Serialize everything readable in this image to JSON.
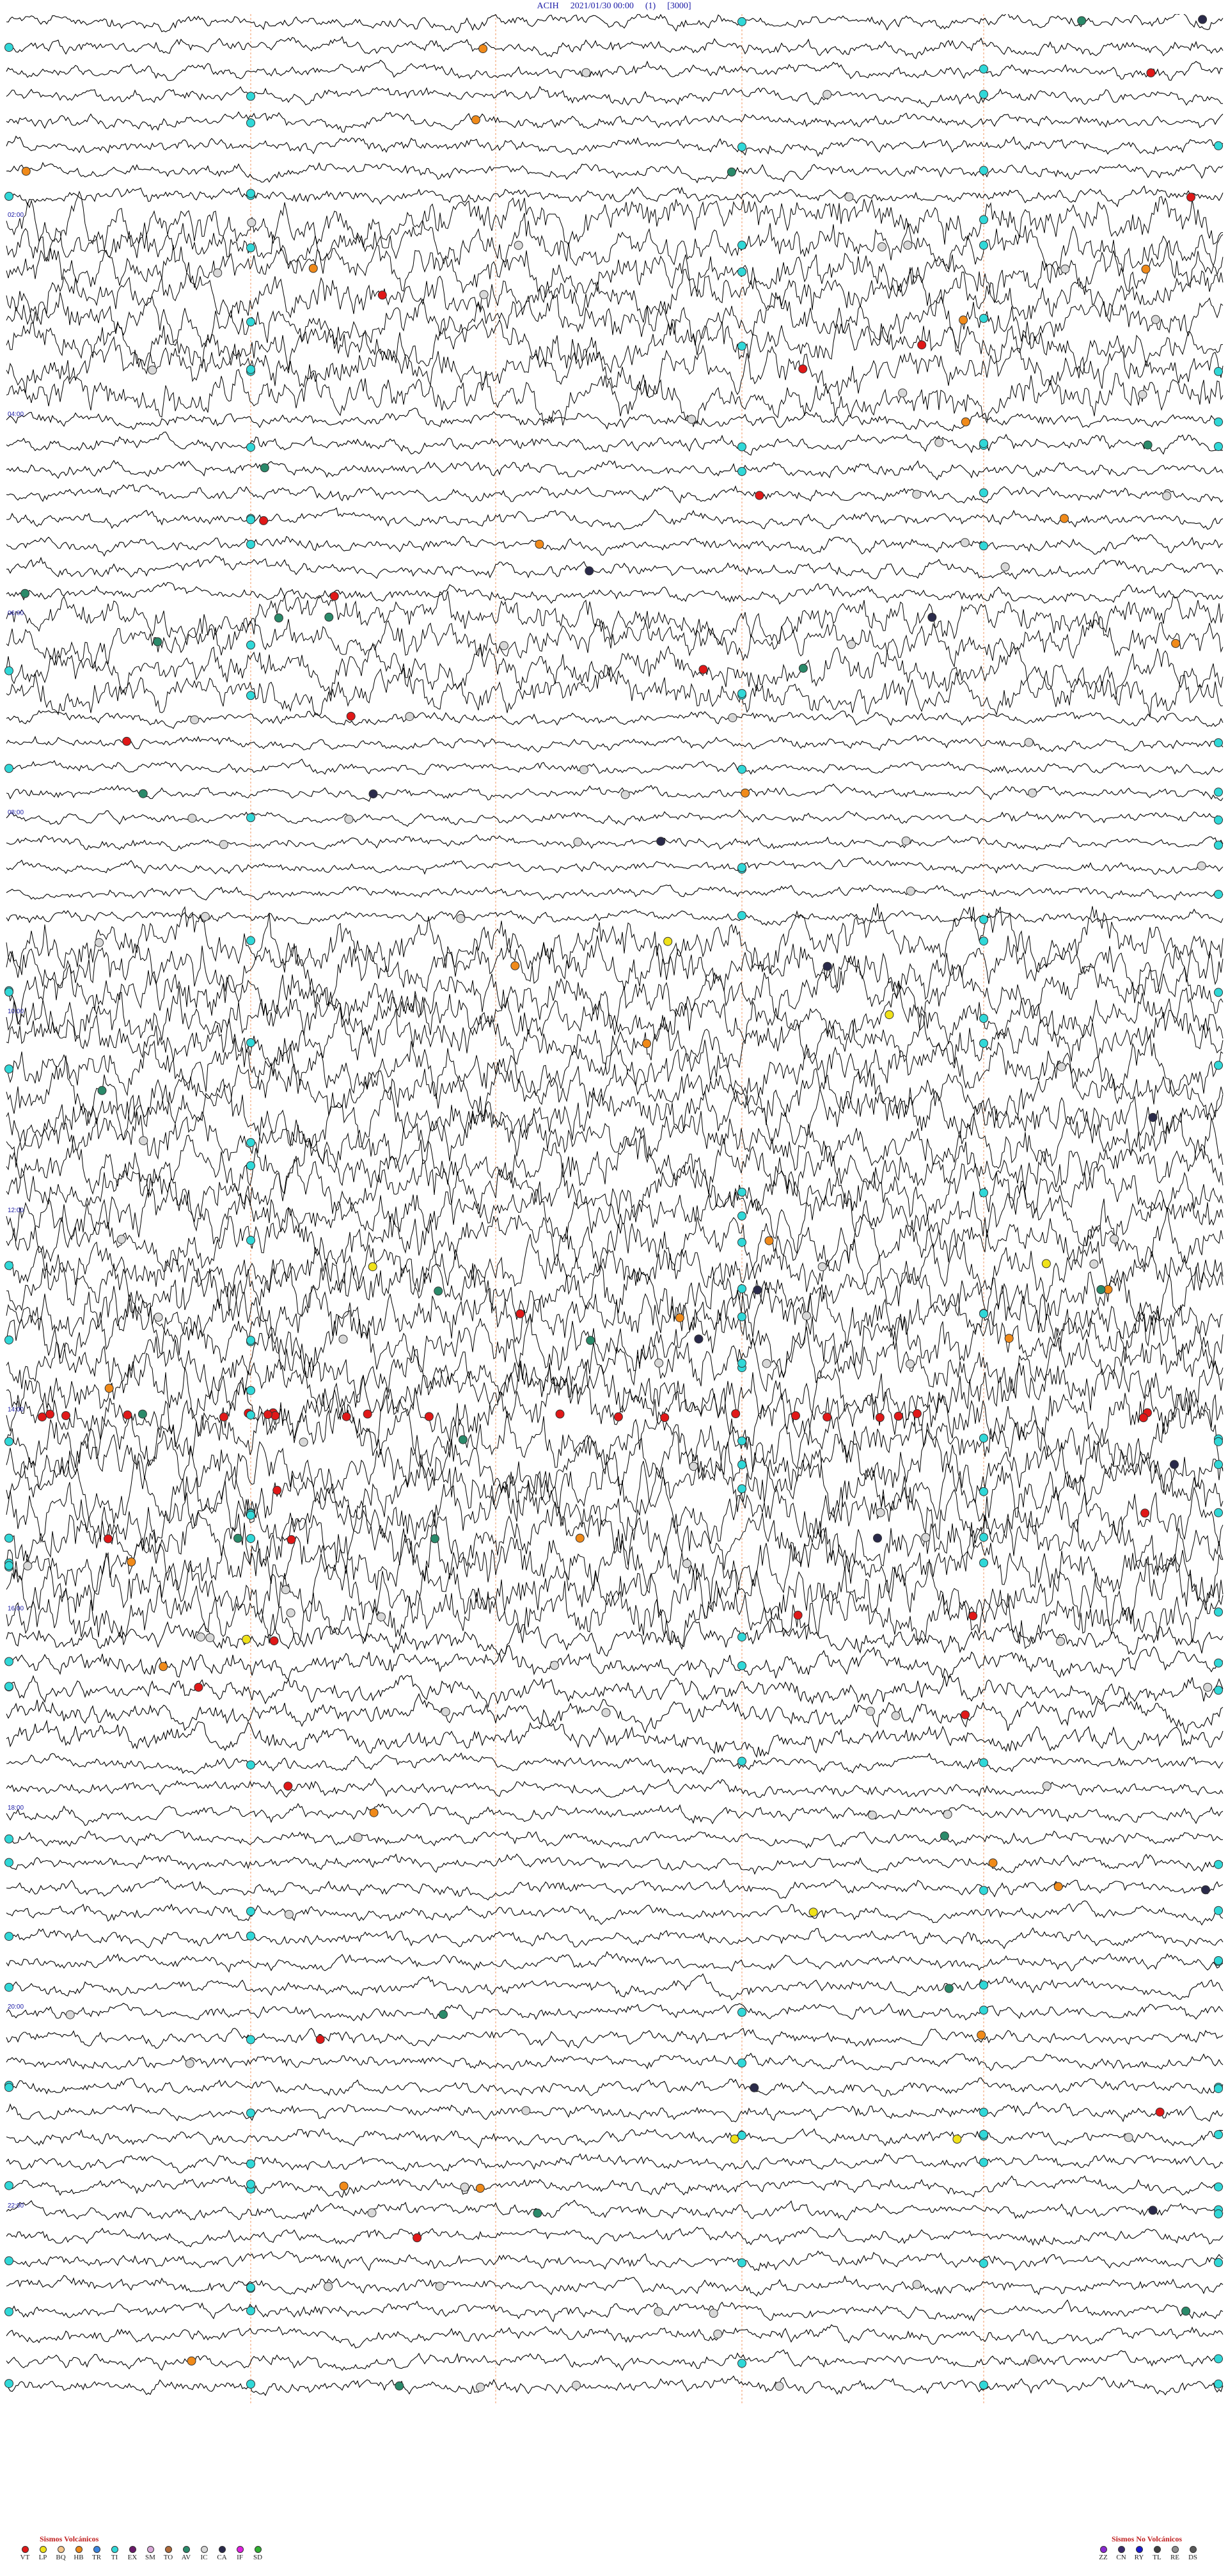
{
  "header": {
    "station": "ACIH",
    "datetime": "2021/01/30 00:00",
    "channel": "(1)",
    "scale": "[3000]"
  },
  "chart_data": {
    "type": "helicorder",
    "station": "ACIH",
    "start": "2021/01/30 00:00",
    "hour_labels": [
      "02:00",
      "04:00",
      "06:00",
      "08:00",
      "10:00",
      "12:00",
      "14:00",
      "16:00",
      "18:00",
      "20:00",
      "22:00"
    ],
    "trace_color": "#000000",
    "minute_marker_color": "#f4a77a",
    "noise_bands": [
      {
        "from_hour": 0,
        "to_hour": 2,
        "level": 1.0
      },
      {
        "from_hour": 2,
        "to_hour": 4,
        "level": 3.6
      },
      {
        "from_hour": 4,
        "to_hour": 5.8,
        "level": 1.0
      },
      {
        "from_hour": 5.8,
        "to_hour": 6.8,
        "level": 3.2
      },
      {
        "from_hour": 6.8,
        "to_hour": 7.3,
        "level": 0.8
      },
      {
        "from_hour": 7.3,
        "to_hour": 9.2,
        "level": 0.7
      },
      {
        "from_hour": 9.2,
        "to_hour": 12.6,
        "level": 4.2
      },
      {
        "from_hour": 12.6,
        "to_hour": 16.2,
        "level": 4.8
      },
      {
        "from_hour": 16.2,
        "to_hour": 17.5,
        "level": 2.0
      },
      {
        "from_hour": 17.5,
        "to_hour": 24,
        "level": 1.0
      }
    ],
    "event_counts": {
      "VT": 48,
      "LP": 8,
      "TI": 160,
      "HB": 28,
      "AV": 24,
      "EX": 0,
      "IC": 90,
      "CA": 14
    }
  },
  "legend": {
    "volcanic_title": "Sismos Volcánicos",
    "volcanic_items": [
      {
        "code": "VT",
        "color": "#e01818"
      },
      {
        "code": "LP",
        "color": "#f0e21a"
      },
      {
        "code": "BQ",
        "color": "#f5c58c"
      },
      {
        "code": "HB",
        "color": "#f08a1a"
      },
      {
        "code": "TR",
        "color": "#3a84e0"
      },
      {
        "code": "TI",
        "color": "#30d8d8"
      },
      {
        "code": "EX",
        "color": "#6a1a6a"
      },
      {
        "code": "SM",
        "color": "#d9a8d8"
      },
      {
        "code": "TO",
        "color": "#b06a3a"
      },
      {
        "code": "AV",
        "color": "#2a8a6a"
      },
      {
        "code": "IC",
        "color": "#d8d8d8"
      },
      {
        "code": "CA",
        "color": "#2a2a4a"
      },
      {
        "code": "IF",
        "color": "#e020e0"
      },
      {
        "code": "SD",
        "color": "#30b030"
      }
    ],
    "nonvolcanic_title": "Sismos No Volcánicos",
    "nonvolcanic_items": [
      {
        "code": "ZZ",
        "color": "#8a2ad0"
      },
      {
        "code": "CN",
        "color": "#3a2a6a"
      },
      {
        "code": "RY",
        "color": "#1a1ad0"
      },
      {
        "code": "TL",
        "color": "#404040"
      },
      {
        "code": "RE",
        "color": "#909090"
      },
      {
        "code": "DS",
        "color": "#5a5a5a"
      }
    ]
  }
}
